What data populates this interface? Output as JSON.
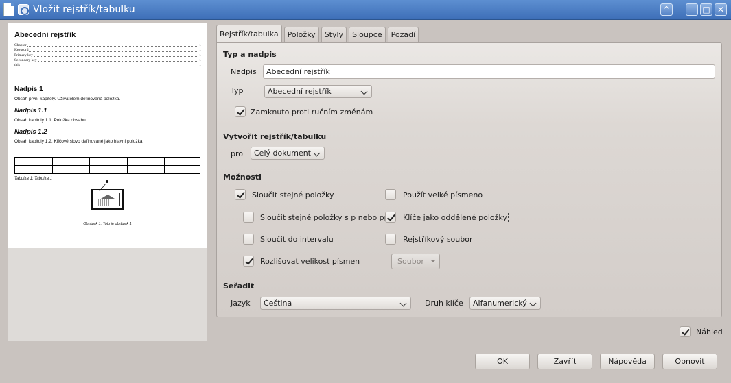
{
  "window": {
    "title": "Vložit rejstřík/tabulku"
  },
  "titlebar_buttons": {
    "up": "^",
    "minimize": "_",
    "maximize": "□",
    "close": "✕"
  },
  "preview": {
    "heading": "Abecední rejstřík",
    "toc": [
      {
        "label": "Chapter",
        "page": "1"
      },
      {
        "label": "Keyword",
        "page": "1"
      },
      {
        "label": "Primary key",
        "page": "1"
      },
      {
        "label": "Secondary key",
        "page": "1"
      },
      {
        "label": "this",
        "page": "1"
      }
    ],
    "h1": "Nadpis 1",
    "h1_text": "Obsah první kapitoly. Uživatelem definovaná položka.",
    "h11": "Nadpis 1.1",
    "h11_text": "Obsah kapitoly 1.1. Položka obsahu.",
    "h12": "Nadpis 1.2",
    "h12_text": "Obsah kapitoly 1.2. Klíčové slovo definované jako hlavní položka.",
    "table_caption": "Tabulka 1: Tabulka 1",
    "figure_caption": "Obrázek 1: Toto je obrázek 1"
  },
  "tabs": [
    {
      "label": "Rejstřík/tabulka",
      "active": true
    },
    {
      "label": "Položky"
    },
    {
      "label": "Styly"
    },
    {
      "label": "Sloupce"
    },
    {
      "label": "Pozadí"
    }
  ],
  "type_section": {
    "title": "Typ a nadpis",
    "title_label": "Nadpis",
    "title_value": "Abecední rejstřík",
    "type_label": "Typ",
    "type_value": "Abecední rejstřík",
    "protect_label": "Zamknuto proti ručním změnám",
    "protect_checked": true
  },
  "create_section": {
    "title": "Vytvořit rejstřík/tabulku",
    "for_label": "pro",
    "for_value": "Celý dokument"
  },
  "options_section": {
    "title": "Možnosti",
    "combine_identical": "Sloučit stejné položky",
    "combine_pp": "Sloučit stejné položky s p nebo pp",
    "combine_range": "Sloučit do intervalu",
    "case_sensitive": "Rozlišovat velikost písmen",
    "auto_capitalize": "Použít velké písmeno",
    "keys_separate": "Klíče jako oddělené položky",
    "concordance": "Rejstříkový soubor",
    "file_button": "Soubor"
  },
  "sort_section": {
    "title": "Seřadit",
    "language_label": "Jazyk",
    "language_value": "Čeština",
    "key_type_label": "Druh klíče",
    "key_type_value": "Alfanumerický"
  },
  "preview_toggle": {
    "label": "Náhled",
    "checked": true
  },
  "buttons": {
    "ok": "OK",
    "close": "Zavřít",
    "help": "Nápověda",
    "reset": "Obnovit"
  },
  "colors": {
    "titlebar": "#4a7dc4",
    "dialog_bg": "#c9c3bf"
  }
}
